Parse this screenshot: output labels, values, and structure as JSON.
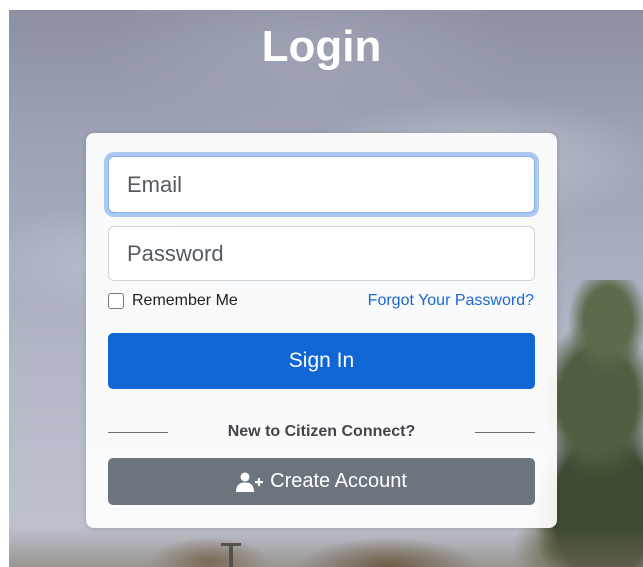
{
  "page": {
    "title": "Login"
  },
  "form": {
    "email_placeholder": "Email",
    "password_placeholder": "Password",
    "remember_label": "Remember Me",
    "remember_checked": false,
    "forgot_link": "Forgot Your Password?",
    "signin_label": "Sign In",
    "divider_text": "New to Citizen Connect?",
    "create_account_label": "Create Account",
    "create_account_icon": "user-plus-icon"
  },
  "colors": {
    "primary": "#1166d6",
    "secondary": "#6c757d",
    "link": "#1a67d2",
    "focus_ring": "#aac8f2"
  }
}
